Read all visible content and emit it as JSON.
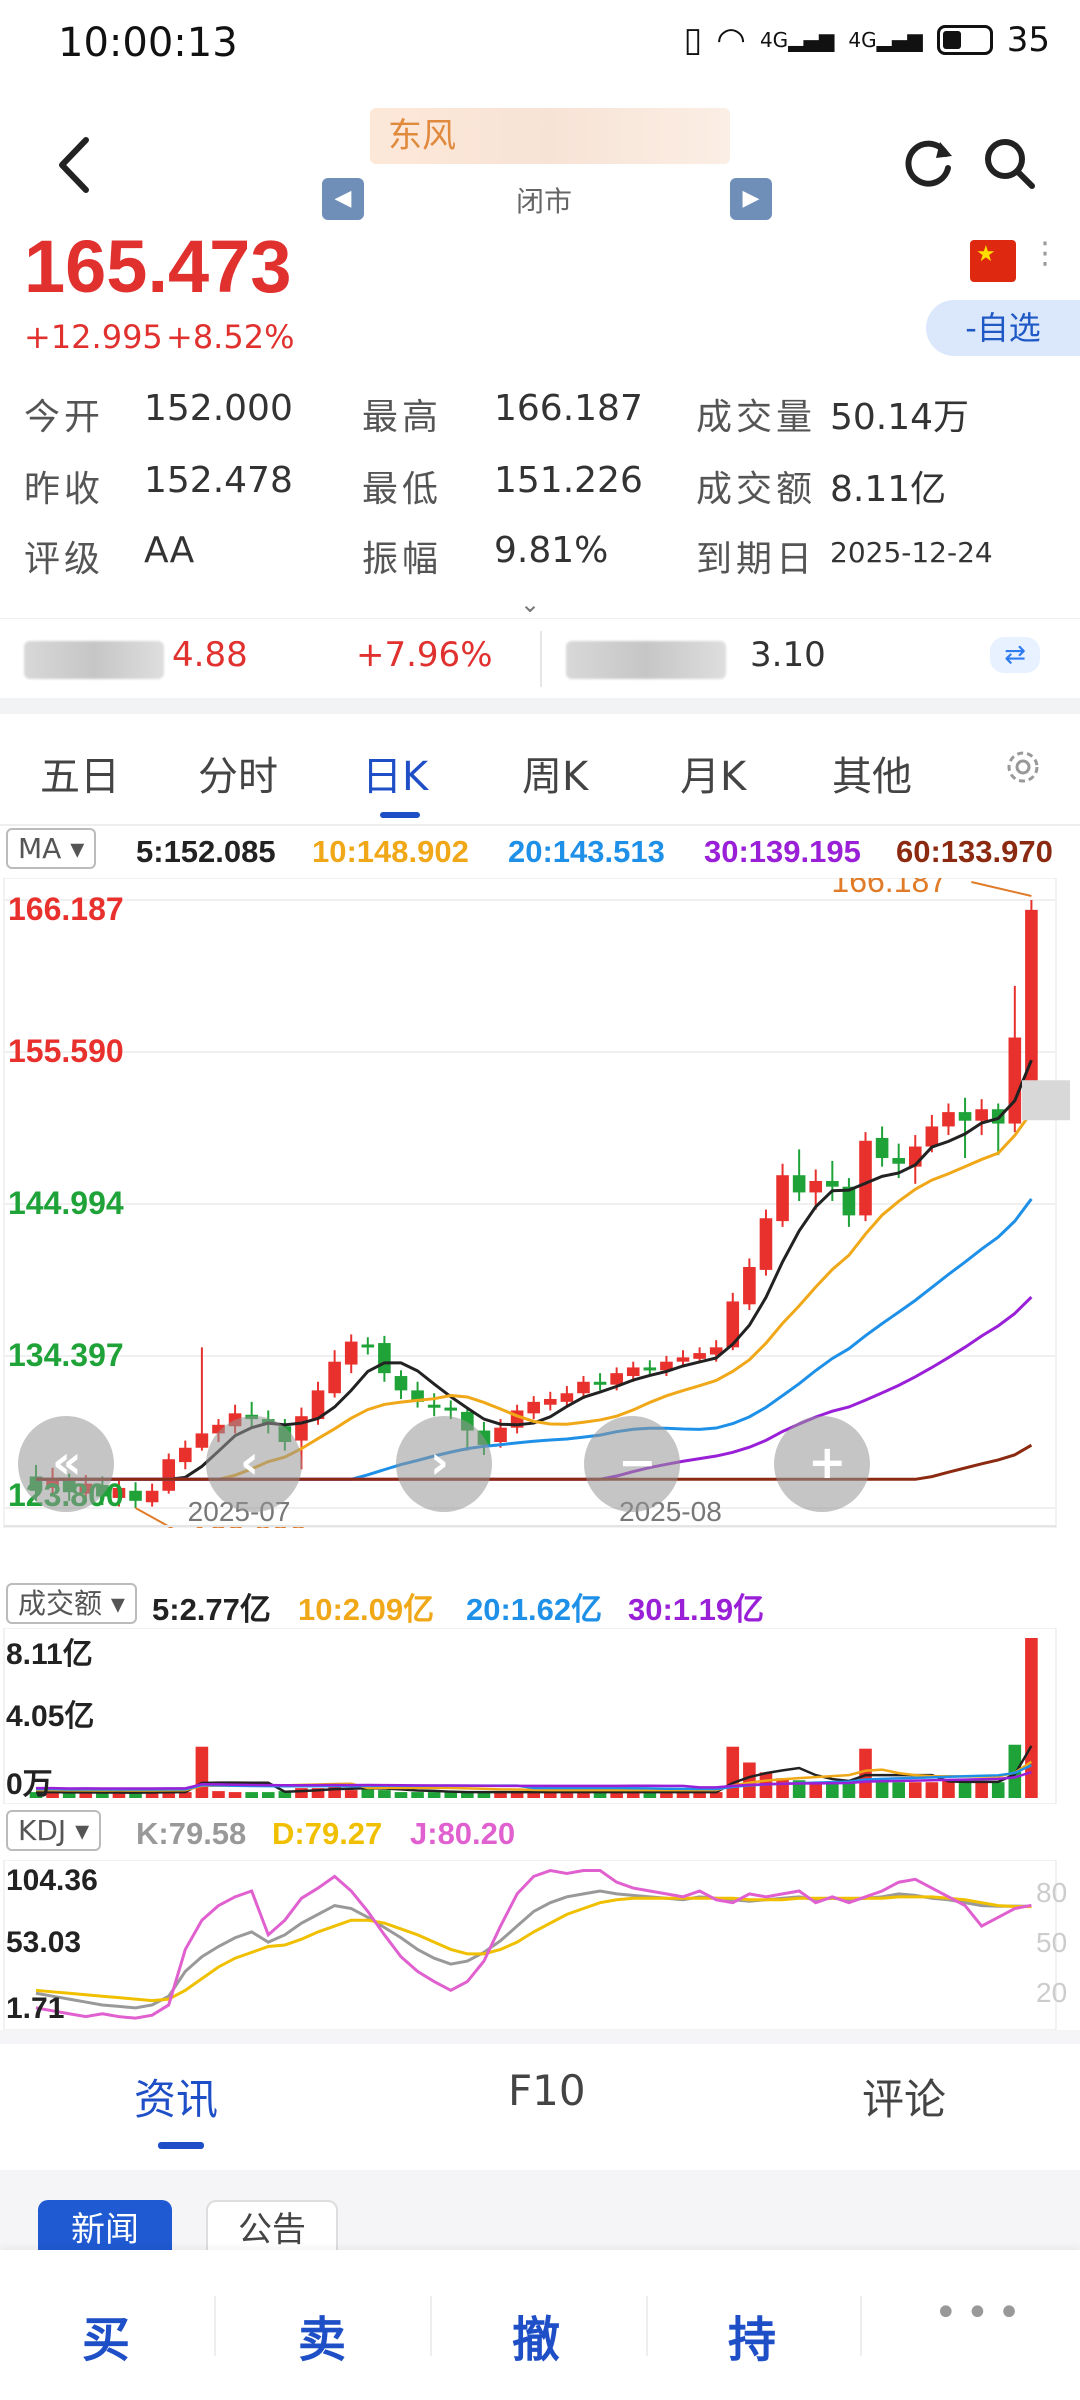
{
  "status_bar": {
    "time": "10:00:13",
    "network1": "4G",
    "network2": "4G",
    "battery": "35"
  },
  "header": {
    "title": "东风",
    "market_status": "闭市",
    "prev_label": "◀",
    "next_label": "▶"
  },
  "quote": {
    "price": "165.473",
    "change": "+12.995",
    "change_pct": "+8.52%",
    "watch_button": "-自选",
    "stats": [
      {
        "label": "今开",
        "value": "152.000"
      },
      {
        "label": "最高",
        "value": "166.187"
      },
      {
        "label": "成交量",
        "value": "50.14万"
      },
      {
        "label": "昨收",
        "value": "152.478"
      },
      {
        "label": "最低",
        "value": "151.226"
      },
      {
        "label": "成交额",
        "value": "8.11亿"
      },
      {
        "label": "评级",
        "value": "AA"
      },
      {
        "label": "振幅",
        "value": "9.81%"
      },
      {
        "label": "到期日",
        "value": "2025-12-24"
      }
    ]
  },
  "related": {
    "value1": "4.88",
    "pct1": "+7.96%",
    "value2": "3.10"
  },
  "period_tabs": [
    "五日",
    "分时",
    "日K",
    "周K",
    "月K",
    "其他"
  ],
  "active_period": "日K",
  "ma_bar": {
    "selector": "MA",
    "values": [
      {
        "label": "5:152.085",
        "color": "#222222"
      },
      {
        "label": "10:148.902",
        "color": "#f0a818"
      },
      {
        "label": "20:143.513",
        "color": "#1e90e8"
      },
      {
        "label": "30:139.195",
        "color": "#9a20d8"
      },
      {
        "label": "60:133.970",
        "color": "#8b2a10"
      }
    ]
  },
  "amount_bar": {
    "selector": "成交额",
    "values": [
      {
        "label": "5:2.77亿",
        "color": "#222222"
      },
      {
        "label": "10:2.09亿",
        "color": "#f0a818"
      },
      {
        "label": "20:1.62亿",
        "color": "#1e90e8"
      },
      {
        "label": "30:1.19亿",
        "color": "#9a20d8"
      }
    ]
  },
  "kdj_bar": {
    "selector": "KDJ",
    "values": [
      {
        "label": "K:79.58",
        "color": "#999999"
      },
      {
        "label": "D:79.27",
        "color": "#f0c000"
      },
      {
        "label": "J:80.20",
        "color": "#e060d0"
      }
    ]
  },
  "chart_data": [
    {
      "type": "candlestick",
      "title": "",
      "y_ticks": [
        "166.187",
        "155.590",
        "144.994",
        "134.397",
        "123.800"
      ],
      "x_ticks": [
        "2025-07",
        "2025-08"
      ],
      "high_label": "166.187",
      "low_label": "123.800",
      "ylim": [
        123.8,
        166.187
      ],
      "candles": [
        {
          "o": 126.0,
          "c": 125.0,
          "h": 126.8,
          "l": 124.3
        },
        {
          "o": 125.2,
          "c": 125.9,
          "h": 126.6,
          "l": 124.6
        },
        {
          "o": 125.8,
          "c": 124.9,
          "h": 126.2,
          "l": 124.3
        },
        {
          "o": 124.8,
          "c": 125.5,
          "h": 126.1,
          "l": 124.2
        },
        {
          "o": 125.4,
          "c": 124.6,
          "h": 126.0,
          "l": 124.0
        },
        {
          "o": 124.5,
          "c": 125.2,
          "h": 125.8,
          "l": 123.9
        },
        {
          "o": 125.0,
          "c": 124.3,
          "h": 125.6,
          "l": 123.8
        },
        {
          "o": 124.2,
          "c": 125.0,
          "h": 125.5,
          "l": 123.9
        },
        {
          "o": 125.0,
          "c": 127.2,
          "h": 127.6,
          "l": 124.8
        },
        {
          "o": 127.0,
          "c": 128.0,
          "h": 128.5,
          "l": 126.5
        },
        {
          "o": 128.0,
          "c": 129.0,
          "h": 135.0,
          "l": 127.8
        },
        {
          "o": 129.0,
          "c": 129.6,
          "h": 130.0,
          "l": 128.4
        },
        {
          "o": 129.5,
          "c": 130.4,
          "h": 131.0,
          "l": 129.0
        },
        {
          "o": 130.3,
          "c": 130.0,
          "h": 131.2,
          "l": 129.5
        },
        {
          "o": 130.0,
          "c": 129.6,
          "h": 130.6,
          "l": 129.0
        },
        {
          "o": 129.5,
          "c": 128.4,
          "h": 130.0,
          "l": 127.8
        },
        {
          "o": 128.5,
          "c": 130.2,
          "h": 130.8,
          "l": 126.5
        },
        {
          "o": 130.0,
          "c": 132.0,
          "h": 132.6,
          "l": 129.6
        },
        {
          "o": 131.8,
          "c": 134.0,
          "h": 134.8,
          "l": 131.5
        },
        {
          "o": 133.8,
          "c": 135.4,
          "h": 135.9,
          "l": 133.2
        },
        {
          "o": 135.2,
          "c": 135.0,
          "h": 135.7,
          "l": 134.5
        },
        {
          "o": 135.3,
          "c": 133.2,
          "h": 135.8,
          "l": 132.6
        },
        {
          "o": 133.0,
          "c": 132.0,
          "h": 133.4,
          "l": 131.4
        },
        {
          "o": 132.0,
          "c": 131.2,
          "h": 132.6,
          "l": 130.8
        },
        {
          "o": 131.0,
          "c": 130.8,
          "h": 131.8,
          "l": 130.2
        },
        {
          "o": 130.8,
          "c": 130.6,
          "h": 131.3,
          "l": 130.0
        },
        {
          "o": 130.5,
          "c": 129.2,
          "h": 130.8,
          "l": 127.8
        },
        {
          "o": 129.2,
          "c": 128.2,
          "h": 129.8,
          "l": 127.5
        },
        {
          "o": 128.4,
          "c": 129.4,
          "h": 130.0,
          "l": 128.0
        },
        {
          "o": 129.4,
          "c": 130.6,
          "h": 131.0,
          "l": 129.0
        },
        {
          "o": 130.4,
          "c": 131.2,
          "h": 131.6,
          "l": 130.0
        },
        {
          "o": 131.0,
          "c": 131.4,
          "h": 131.9,
          "l": 130.6
        },
        {
          "o": 131.2,
          "c": 131.8,
          "h": 132.3,
          "l": 130.8
        },
        {
          "o": 131.8,
          "c": 132.6,
          "h": 133.0,
          "l": 131.4
        },
        {
          "o": 132.6,
          "c": 132.4,
          "h": 133.2,
          "l": 132.0
        },
        {
          "o": 132.4,
          "c": 133.2,
          "h": 133.6,
          "l": 132.0
        },
        {
          "o": 133.0,
          "c": 133.6,
          "h": 134.0,
          "l": 132.6
        },
        {
          "o": 133.6,
          "c": 133.4,
          "h": 134.1,
          "l": 133.0
        },
        {
          "o": 133.4,
          "c": 134.0,
          "h": 134.4,
          "l": 133.0
        },
        {
          "o": 134.0,
          "c": 134.3,
          "h": 134.8,
          "l": 133.6
        },
        {
          "o": 134.2,
          "c": 134.6,
          "h": 135.0,
          "l": 133.9
        },
        {
          "o": 134.5,
          "c": 135.0,
          "h": 135.5,
          "l": 134.0
        },
        {
          "o": 135.0,
          "c": 138.2,
          "h": 138.8,
          "l": 134.8
        },
        {
          "o": 138.0,
          "c": 140.6,
          "h": 141.2,
          "l": 137.6
        },
        {
          "o": 140.4,
          "c": 144.0,
          "h": 144.6,
          "l": 140.0
        },
        {
          "o": 143.8,
          "c": 147.0,
          "h": 147.8,
          "l": 143.4
        },
        {
          "o": 147.0,
          "c": 145.8,
          "h": 148.8,
          "l": 145.2
        },
        {
          "o": 145.8,
          "c": 146.6,
          "h": 147.4,
          "l": 144.6
        },
        {
          "o": 146.6,
          "c": 146.2,
          "h": 148.0,
          "l": 145.2
        },
        {
          "o": 146.2,
          "c": 144.2,
          "h": 146.8,
          "l": 143.4
        },
        {
          "o": 144.2,
          "c": 149.4,
          "h": 150.0,
          "l": 143.8
        },
        {
          "o": 149.6,
          "c": 148.2,
          "h": 150.4,
          "l": 147.6
        },
        {
          "o": 148.2,
          "c": 147.8,
          "h": 149.2,
          "l": 146.8
        },
        {
          "o": 147.6,
          "c": 149.0,
          "h": 149.8,
          "l": 146.4
        },
        {
          "o": 149.0,
          "c": 150.4,
          "h": 151.2,
          "l": 148.6
        },
        {
          "o": 150.4,
          "c": 151.4,
          "h": 152.0,
          "l": 149.8
        },
        {
          "o": 151.4,
          "c": 150.8,
          "h": 152.4,
          "l": 148.2
        },
        {
          "o": 150.8,
          "c": 151.6,
          "h": 152.3,
          "l": 149.8
        },
        {
          "o": 151.6,
          "c": 150.6,
          "h": 152.0,
          "l": 148.4
        },
        {
          "o": 150.6,
          "c": 156.6,
          "h": 160.2,
          "l": 150.0
        },
        {
          "o": 152.4,
          "c": 165.5,
          "h": 166.187,
          "l": 151.226
        }
      ]
    },
    {
      "type": "bar",
      "title": "成交额",
      "y_ticks": [
        "8.11亿",
        "4.05亿",
        "0万"
      ],
      "ylim": [
        0,
        8.11
      ],
      "values": [
        0.3,
        0.3,
        0.25,
        0.3,
        0.25,
        0.3,
        0.25,
        0.3,
        0.35,
        0.3,
        2.6,
        0.35,
        0.3,
        0.3,
        0.3,
        0.35,
        0.5,
        0.5,
        0.6,
        0.4,
        0.5,
        0.4,
        0.3,
        0.3,
        0.3,
        0.3,
        0.3,
        0.3,
        0.3,
        0.3,
        0.3,
        0.3,
        0.3,
        0.3,
        0.3,
        0.3,
        0.3,
        0.3,
        0.3,
        0.3,
        0.3,
        0.3,
        2.6,
        1.8,
        1.3,
        1.0,
        0.9,
        0.8,
        0.8,
        0.8,
        2.5,
        0.9,
        0.8,
        0.8,
        0.8,
        0.9,
        0.8,
        0.8,
        0.8,
        2.7,
        8.11
      ],
      "up": [
        0,
        1,
        0,
        1,
        0,
        1,
        0,
        1,
        1,
        1,
        1,
        1,
        1,
        0,
        0,
        0,
        1,
        1,
        1,
        1,
        0,
        0,
        0,
        0,
        0,
        0,
        0,
        0,
        1,
        1,
        1,
        1,
        1,
        1,
        0,
        1,
        1,
        0,
        1,
        1,
        1,
        1,
        1,
        1,
        1,
        1,
        0,
        1,
        0,
        0,
        1,
        0,
        0,
        1,
        1,
        1,
        0,
        1,
        0,
        0,
        1
      ]
    },
    {
      "type": "line",
      "title": "KDJ",
      "y_ticks": [
        "104.36",
        "53.03",
        "1.71"
      ],
      "right_ticks": [
        "80",
        "50",
        "20"
      ],
      "ylim": [
        1.71,
        104.36
      ],
      "series": [
        {
          "name": "K",
          "values": [
            20,
            18,
            16,
            14,
            12,
            11,
            10,
            12,
            18,
            35,
            45,
            52,
            58,
            62,
            55,
            60,
            68,
            74,
            80,
            78,
            72,
            65,
            58,
            50,
            44,
            40,
            42,
            48,
            56,
            66,
            76,
            82,
            86,
            88,
            90,
            88,
            87,
            86,
            85,
            84,
            86,
            85,
            84,
            83,
            84,
            85,
            86,
            84,
            85,
            84,
            85,
            86,
            88,
            87,
            85,
            84,
            82,
            80,
            79.58,
            79.6,
            79.58
          ]
        },
        {
          "name": "D",
          "values": [
            22,
            21,
            20,
            19,
            18,
            17,
            16,
            15,
            16,
            22,
            30,
            38,
            44,
            48,
            52,
            53,
            57,
            62,
            66,
            70,
            70,
            68,
            64,
            60,
            55,
            50,
            47,
            47,
            50,
            55,
            62,
            68,
            74,
            78,
            82,
            84,
            85,
            85,
            85,
            85,
            85,
            85,
            85,
            84,
            84,
            84,
            85,
            85,
            85,
            85,
            85,
            85,
            86,
            86,
            86,
            85,
            84,
            82,
            80,
            79.4,
            79.27
          ]
        },
        {
          "name": "J",
          "values": [
            10,
            8,
            6,
            4,
            6,
            4,
            3,
            5,
            12,
            50,
            70,
            80,
            86,
            90,
            60,
            70,
            85,
            92,
            100,
            90,
            76,
            60,
            45,
            35,
            28,
            22,
            28,
            42,
            66,
            88,
            100,
            104,
            102,
            104,
            104,
            96,
            92,
            90,
            88,
            86,
            90,
            84,
            82,
            88,
            86,
            88,
            90,
            82,
            86,
            82,
            86,
            90,
            96,
            98,
            92,
            86,
            80,
            66,
            72,
            78,
            80.2
          ]
        }
      ]
    }
  ],
  "news_tabs": [
    "资讯",
    "F10",
    "评论"
  ],
  "sub_tabs": [
    "新闻",
    "公告"
  ],
  "actions": [
    "买",
    "卖",
    "撤",
    "持"
  ]
}
